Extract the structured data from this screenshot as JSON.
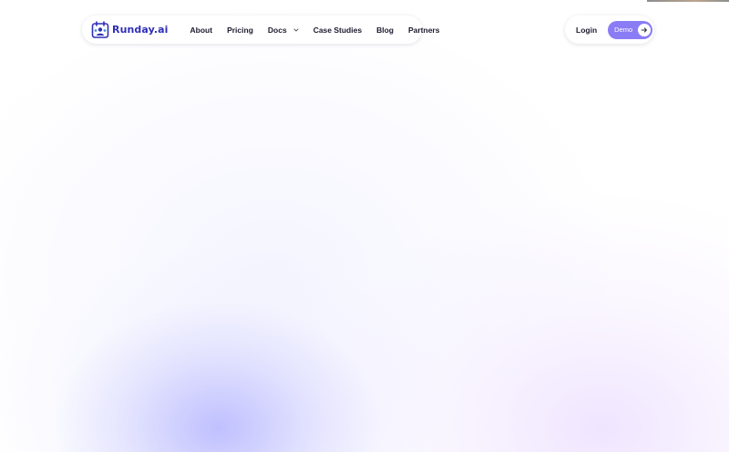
{
  "brand": {
    "name": "Runday.ai",
    "logo_icon": "team-calendar-icon",
    "color": "#2f2fb9"
  },
  "nav": {
    "links": [
      {
        "label": "About"
      },
      {
        "label": "Pricing"
      },
      {
        "label": "Docs",
        "icon": "chevron-down-icon"
      },
      {
        "label": "Case Studies"
      },
      {
        "label": "Blog"
      },
      {
        "label": "Partners"
      }
    ]
  },
  "auth": {
    "login_label": "Login",
    "demo_label": "Demo",
    "demo_icon": "arrow-right-icon",
    "accent_color": "#8a7cf5"
  }
}
